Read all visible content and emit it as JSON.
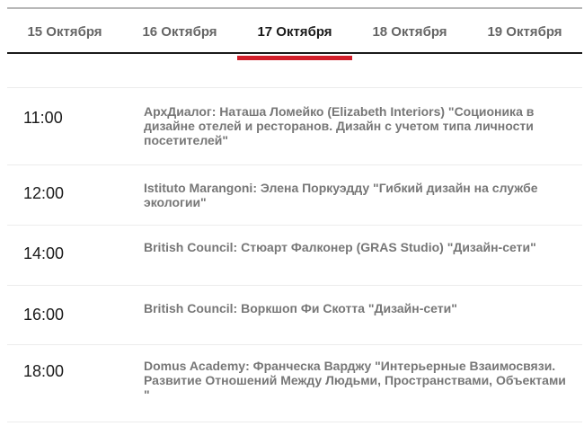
{
  "tabs": [
    {
      "label": "15 Октября"
    },
    {
      "label": "16 Октября"
    },
    {
      "label": "17 Октября"
    },
    {
      "label": "18 Октября"
    },
    {
      "label": "19 Октября"
    }
  ],
  "active_tab": "17 Октября",
  "accent_color": "#d21f2b",
  "schedule": [
    {
      "time": "11:00",
      "title": "АрхДиалог: Наташа Ломейко (Elizabeth Interiors) \"Соционика в дизайне отелей и ресторанов. Дизайн с учетом типа личности посетителей\""
    },
    {
      "time": "12:00",
      "title": "Istituto Marangoni: Элена Поркуэдду \"Гибкий дизайн на службе экологии\""
    },
    {
      "time": "14:00",
      "title": "British Council: Стюарт Фалконер (GRAS Studio) \"Дизайн-сети\""
    },
    {
      "time": "16:00",
      "title": "British Council: Воркшоп Фи Скотта \"Дизайн-сети\""
    },
    {
      "time": "18:00",
      "title": "Domus Academy: Франческа Варджу \"Интерьерные Взаимосвязи. Развитие Отношений Между Людьми, Пространствами, Объектами \""
    }
  ]
}
